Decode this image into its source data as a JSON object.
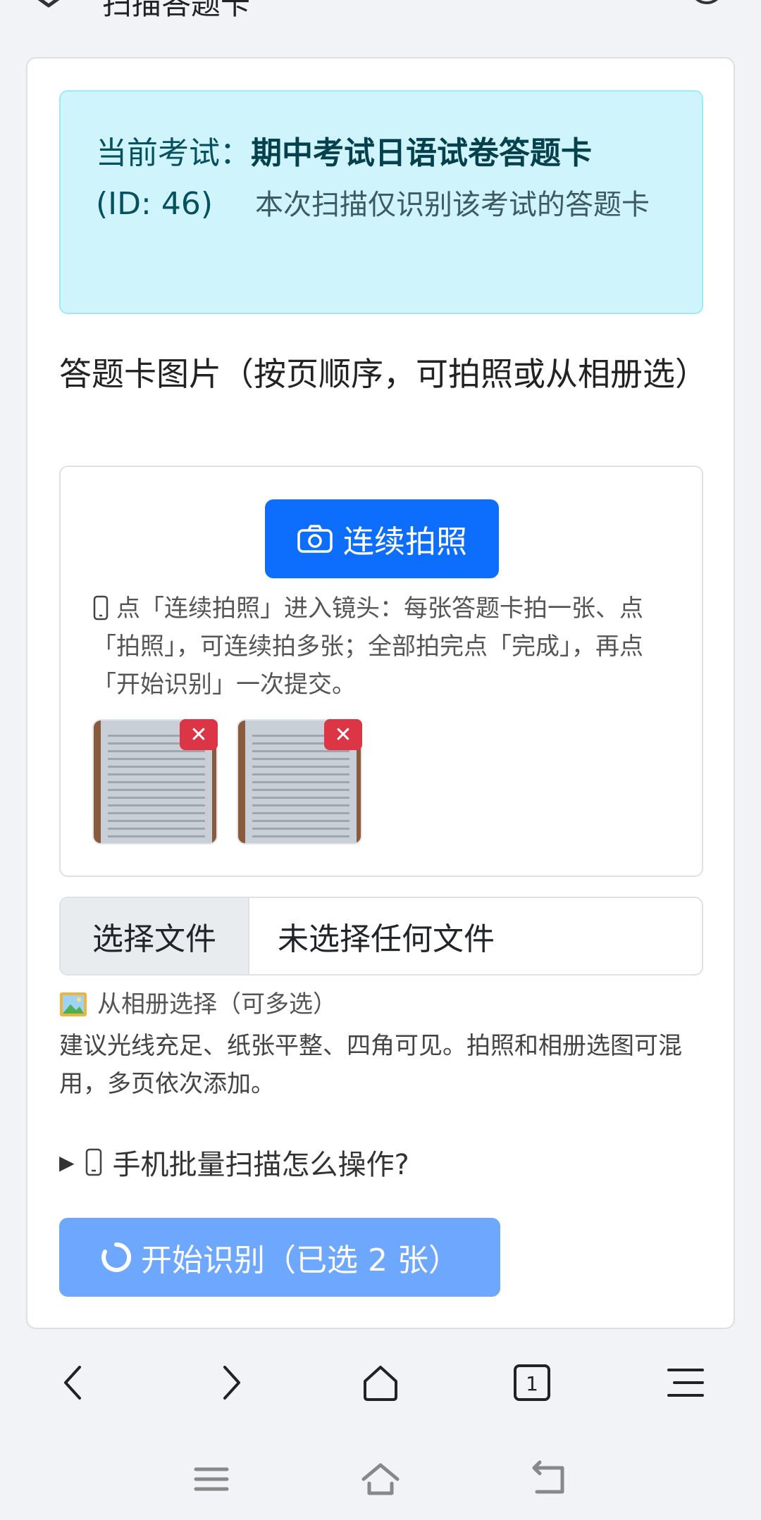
{
  "header": {
    "title": "扫描答题卡"
  },
  "exam_alert": {
    "prefix": "当前考试：",
    "exam_name": "期中考试日语试卷答题卡",
    "exam_id": "(ID: 46)",
    "note": "本次扫描仅识别该考试的答题卡"
  },
  "section_label": "答题卡图片（按页顺序，可拍照或从相册选）",
  "camera_button": {
    "label": "连续拍照",
    "icon": "camera-icon"
  },
  "camera_hint": "点「连续拍照」进入镜头：每张答题卡拍一张、点「拍照」，可连续拍多张；全部拍完点「完成」，再点「开始识别」一次提交。",
  "thumbnails": [
    {
      "delete_label": "✕"
    },
    {
      "delete_label": "✕"
    }
  ],
  "file_input": {
    "button_label": "选择文件",
    "status": "未选择任何文件"
  },
  "album_label": "从相册选择（可多选）",
  "tips": "建议光线充足、纸张平整、四角可见。拍照和相册选图可混用，多页依次添加。",
  "details_summary": "手机批量扫描怎么操作?",
  "start_button": {
    "label": "开始识别（已选 2 张）"
  },
  "browser_nav": {
    "tab_count": "1"
  },
  "colors": {
    "primary": "#0d6efd",
    "primary_disabled": "#6ea8fe",
    "alert_bg": "#cff4fc",
    "alert_text": "#055160",
    "danger": "#dc3545"
  }
}
